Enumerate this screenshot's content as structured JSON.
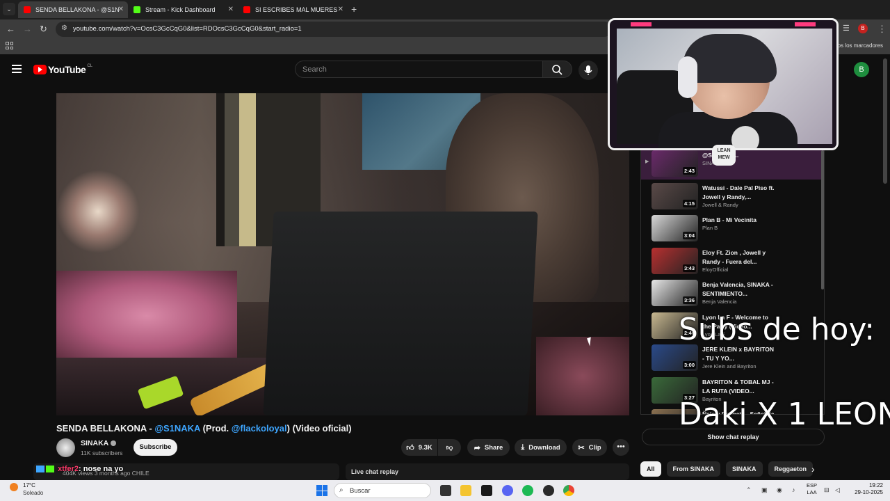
{
  "browser": {
    "tabs": [
      {
        "title": "SENDA BELLAKONA - @S1NAKA",
        "favicon_color": "#ff0000",
        "active": true
      },
      {
        "title": "Stream - Kick Dashboard",
        "favicon_color": "#53fc18",
        "active": false
      },
      {
        "title": "SI ESCRIBES MAL MUERES 💀",
        "favicon_color": "#ff0000",
        "active": false
      }
    ],
    "url": "youtube.com/watch?v=OcsC3GcCqG0&list=RDOcsC3GcCqG0&start_radio=1",
    "bookmarks_text": "os los marcadores",
    "profile_letter": "B"
  },
  "youtube": {
    "logo_text": "YouTube",
    "country_code": "CL",
    "search_placeholder": "Search",
    "avatar_letter": "B",
    "video": {
      "title_prefix": "SENDA BELLAKONA - ",
      "title_link1": "@S1NAKA",
      "title_mid": " (Prod. ",
      "title_link2": "@flackoloyal",
      "title_suffix": ") (Video oficial)"
    },
    "channel": {
      "name": "SINAKA",
      "subscribers": "11K subscribers"
    },
    "subscribe_label": "Subscribe",
    "actions": {
      "likes": "9.3K",
      "share": "Share",
      "download": "Download",
      "clip": "Clip"
    },
    "description_views": "404K views  3 months ago  CHILE",
    "chat_overlay": {
      "user": "xtfer2",
      "message": ": nose na yo"
    },
    "live_chat_replay": "Live chat replay",
    "show_chat_replay": "Show chat replay",
    "playlist": [
      {
        "title": "@S... Prod....",
        "channel": "SINAKA",
        "duration": "2:43",
        "active": true,
        "thumb": "#6a2a6a"
      },
      {
        "title": "Watussi - Dale Pal Piso ft. Jowell y Randy,...",
        "channel": "Jowell & Randy",
        "duration": "4:15",
        "thumb": "#5a4a48"
      },
      {
        "title": "Plan B - Mi Vecinita",
        "channel": "Plan B",
        "duration": "3:04",
        "thumb": "#d8d8d8"
      },
      {
        "title": "Eloy Ft. Zion , Jowell y Randy - Fuera del...",
        "channel": "EloyOfficial",
        "duration": "3:43",
        "thumb": "#b83030"
      },
      {
        "title": "Benja Valencia, SINAKA - SENTIMIENTO...",
        "channel": "Benja Valencia",
        "duration": "3:36",
        "thumb": "#e8e8e8"
      },
      {
        "title": "Lyon La F - Welcome to the Party (Video...",
        "channel": "Lyon La F",
        "duration": "2:46",
        "thumb": "#c8b890"
      },
      {
        "title": "JERE KLEIN x BAYRITON - TU Y YO...",
        "channel": "Jere Klein and Bayriton",
        "duration": "3:00",
        "thumb": "#2a4a8a"
      },
      {
        "title": "BAYRITON & TOBAL MJ - LA RUTA (VIDEO...",
        "channel": "Bayriton",
        "duration": "3:27",
        "thumb": "#3a6a3a"
      },
      {
        "title": "Ñejo y Dalmata - Señal de Vida",
        "channel": "",
        "duration": "",
        "thumb": "#8a7050"
      }
    ],
    "chips": [
      "All",
      "From SINAKA",
      "SINAKA",
      "Reggaeton"
    ]
  },
  "stream_overlay": {
    "subs_title": "Subs de hoy:",
    "subs_name": "Daki X 1 LEON",
    "webcam_badge": "LEAN MEW"
  },
  "taskbar": {
    "temperature": "17°C",
    "weather": "Soleado",
    "search_label": "Buscar",
    "lang_top": "ESP",
    "lang_bottom": "LAA",
    "time": "19:22",
    "date": "29-10-2025"
  },
  "colors": {
    "yt_bg": "#0f0f0f",
    "link": "#3ea6ff",
    "brand_red": "#ff0000",
    "overlay_pink": "#ff3b7e"
  }
}
